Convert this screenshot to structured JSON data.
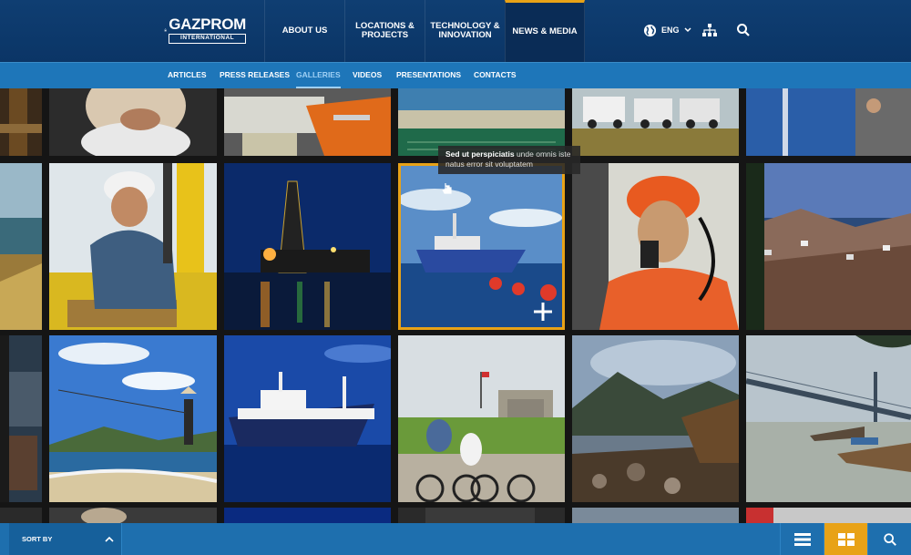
{
  "header": {
    "logo": {
      "name": "GAZPROM",
      "sub": "INTERNATIONAL"
    },
    "nav": [
      {
        "label": "ABOUT US",
        "active": false
      },
      {
        "label": "LOCATIONS &\nPROJECTS",
        "active": false
      },
      {
        "label": "TECHNOLOGY &\nINNOVATION",
        "active": false
      },
      {
        "label": "NEWS & MEDIA",
        "active": true
      }
    ],
    "language": "ENG",
    "icons": [
      "globe-icon",
      "chevron-down-icon",
      "sitemap-icon",
      "search-icon"
    ]
  },
  "subnav": {
    "items": [
      {
        "label": "ARTICLES",
        "active": false
      },
      {
        "label": "PRESS RELEASES",
        "active": false
      },
      {
        "label": "GALLERIES",
        "active": true
      },
      {
        "label": "VIDEOS",
        "active": false
      },
      {
        "label": "PRESENTATIONS",
        "active": false
      },
      {
        "label": "CONTACTS",
        "active": false
      }
    ]
  },
  "tooltip": {
    "bold": "Sed ut perspiciatis",
    "rest": " unde omnis iste natus error sit voluptatem"
  },
  "bottom_bar": {
    "sort_label": "SORT BY",
    "view_buttons": [
      "list-view-icon",
      "grid-view-icon",
      "search-icon"
    ],
    "active_view": "grid-view-icon"
  },
  "colors": {
    "header_bg": "#0f3e72",
    "subnav_bg": "#1e76b9",
    "accent": "#e8a217",
    "bottom_bar_bg": "#1e6fae"
  }
}
